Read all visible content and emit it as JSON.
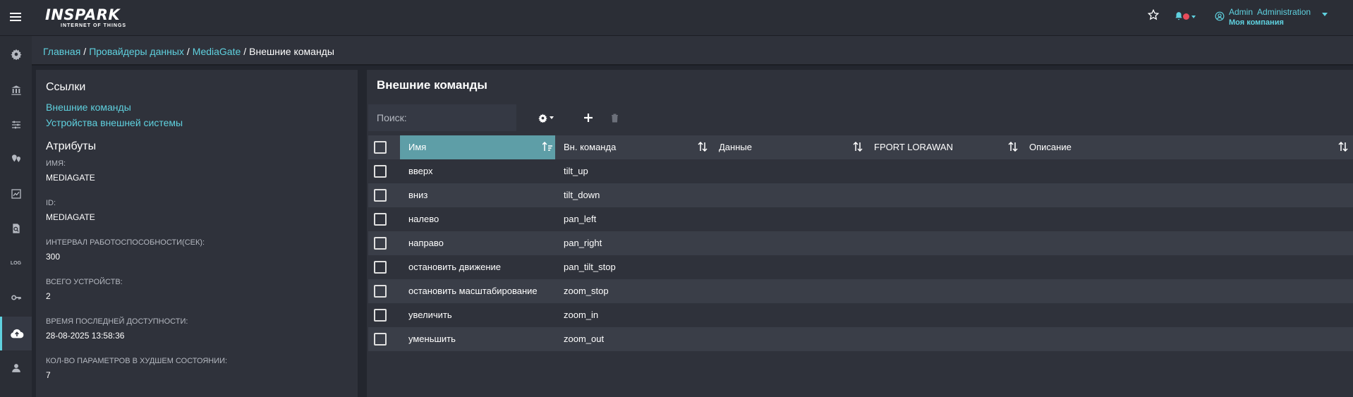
{
  "header": {
    "logo_main": "INSPARK",
    "logo_sub": "INTERNET OF THINGS",
    "user_name": "Admin  Administration",
    "user_company": "Моя компания"
  },
  "sidebar": {
    "items": [
      {
        "icon": "gear-icon"
      },
      {
        "icon": "bank-icon"
      },
      {
        "icon": "sliders-icon"
      },
      {
        "icon": "pins-icon"
      },
      {
        "icon": "dashboard-icon"
      },
      {
        "icon": "document-search-icon"
      },
      {
        "icon": "log-icon",
        "label": "LOG"
      },
      {
        "icon": "key-icon"
      },
      {
        "icon": "cloud-upload-icon",
        "active": true
      },
      {
        "icon": "user-icon"
      }
    ]
  },
  "breadcrumb": {
    "items": [
      "Главная",
      "Провайдеры данных",
      "MediaGate"
    ],
    "current": "Внешние команды"
  },
  "left_panel": {
    "links_heading": "Ссылки",
    "links": [
      "Внешние команды",
      "Устройства внешней системы"
    ],
    "attributes_heading": "Атрибуты",
    "attributes": [
      {
        "label": "ИМЯ:",
        "value": "MEDIAGATE"
      },
      {
        "label": "ID:",
        "value": "MEDIAGATE"
      },
      {
        "label": "ИНТЕРВАЛ РАБОТОСПОСОБНОСТИ(СЕК):",
        "value": "300"
      },
      {
        "label": "ВСЕГО УСТРОЙСТВ:",
        "value": "2"
      },
      {
        "label": "ВРЕМЯ ПОСЛЕДНЕЙ ДОСТУПНОСТИ:",
        "value": "28-08-2025 13:58:36"
      },
      {
        "label": "КОЛ-ВО ПАРАМЕТРОВ В ХУДШЕМ СОСТОЯНИИ:",
        "value": "7"
      }
    ]
  },
  "main": {
    "title": "Внешние команды",
    "search_placeholder": "Поиск:",
    "columns": [
      "Имя",
      "Вн. команда",
      "Данные",
      "FPORT LORAWAN",
      "Описание"
    ],
    "rows": [
      {
        "name": "вверх",
        "command": "tilt_up"
      },
      {
        "name": "вниз",
        "command": "tilt_down"
      },
      {
        "name": "налево",
        "command": "pan_left"
      },
      {
        "name": "направо",
        "command": "pan_right"
      },
      {
        "name": "остановить движение",
        "command": "pan_tilt_stop"
      },
      {
        "name": "остановить масштабирование",
        "command": "zoom_stop"
      },
      {
        "name": "увеличить",
        "command": "zoom_in"
      },
      {
        "name": "уменьшить",
        "command": "zoom_out"
      }
    ]
  },
  "colors": {
    "accent": "#5fd1df",
    "sorted_header": "#5e9ea7",
    "notification_dot": "#e74c5b"
  }
}
